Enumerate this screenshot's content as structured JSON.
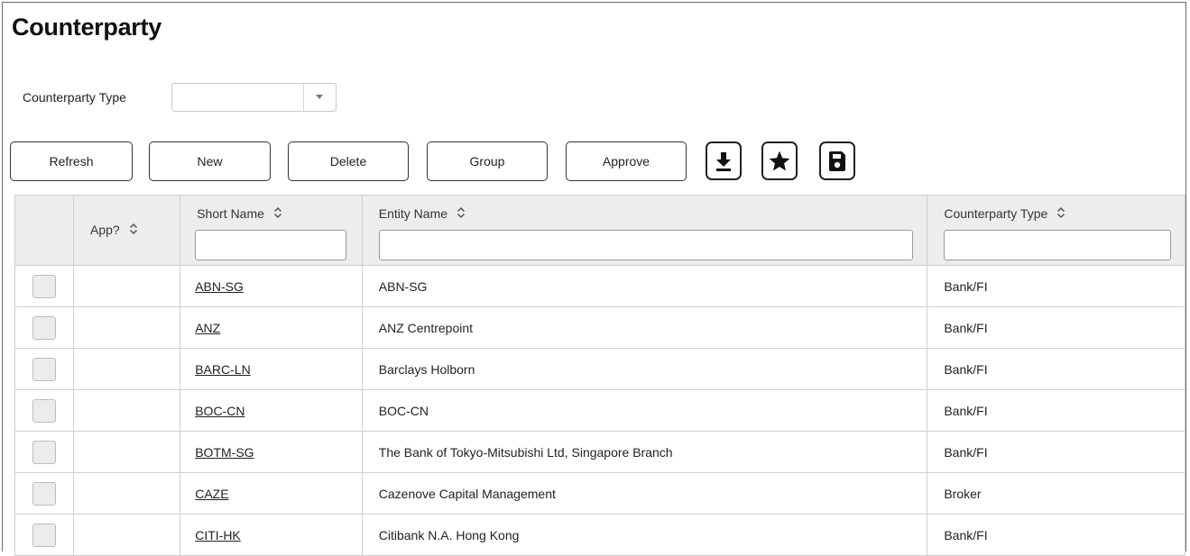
{
  "page": {
    "title": "Counterparty"
  },
  "filter": {
    "label": "Counterparty Type",
    "value": ""
  },
  "toolbar": {
    "buttons": [
      {
        "label": "Refresh"
      },
      {
        "label": "New"
      },
      {
        "label": "Delete"
      },
      {
        "label": "Group"
      },
      {
        "label": "Approve"
      }
    ],
    "icons": [
      "download-icon",
      "star-icon",
      "save-icon"
    ]
  },
  "grid": {
    "columns": [
      {
        "label": ""
      },
      {
        "label": "App?"
      },
      {
        "label": "Short Name",
        "filter_value": ""
      },
      {
        "label": "Entity Name",
        "filter_value": ""
      },
      {
        "label": "Counterparty Type",
        "filter_value": ""
      }
    ],
    "rows": [
      {
        "short_name": "ABN-SG",
        "entity_name": "ABN-SG",
        "type": "Bank/FI"
      },
      {
        "short_name": "ANZ",
        "entity_name": "ANZ Centrepoint",
        "type": "Bank/FI"
      },
      {
        "short_name": "BARC-LN",
        "entity_name": "Barclays Holborn",
        "type": "Bank/FI"
      },
      {
        "short_name": "BOC-CN",
        "entity_name": "BOC-CN",
        "type": "Bank/FI"
      },
      {
        "short_name": "BOTM-SG",
        "entity_name": "The Bank of Tokyo-Mitsubishi Ltd, Singapore Branch",
        "type": "Bank/FI"
      },
      {
        "short_name": "CAZE",
        "entity_name": "Cazenove Capital Management",
        "type": "Broker"
      },
      {
        "short_name": "CITI-HK",
        "entity_name": "Citibank N.A. Hong Kong",
        "type": "Bank/FI"
      }
    ]
  }
}
